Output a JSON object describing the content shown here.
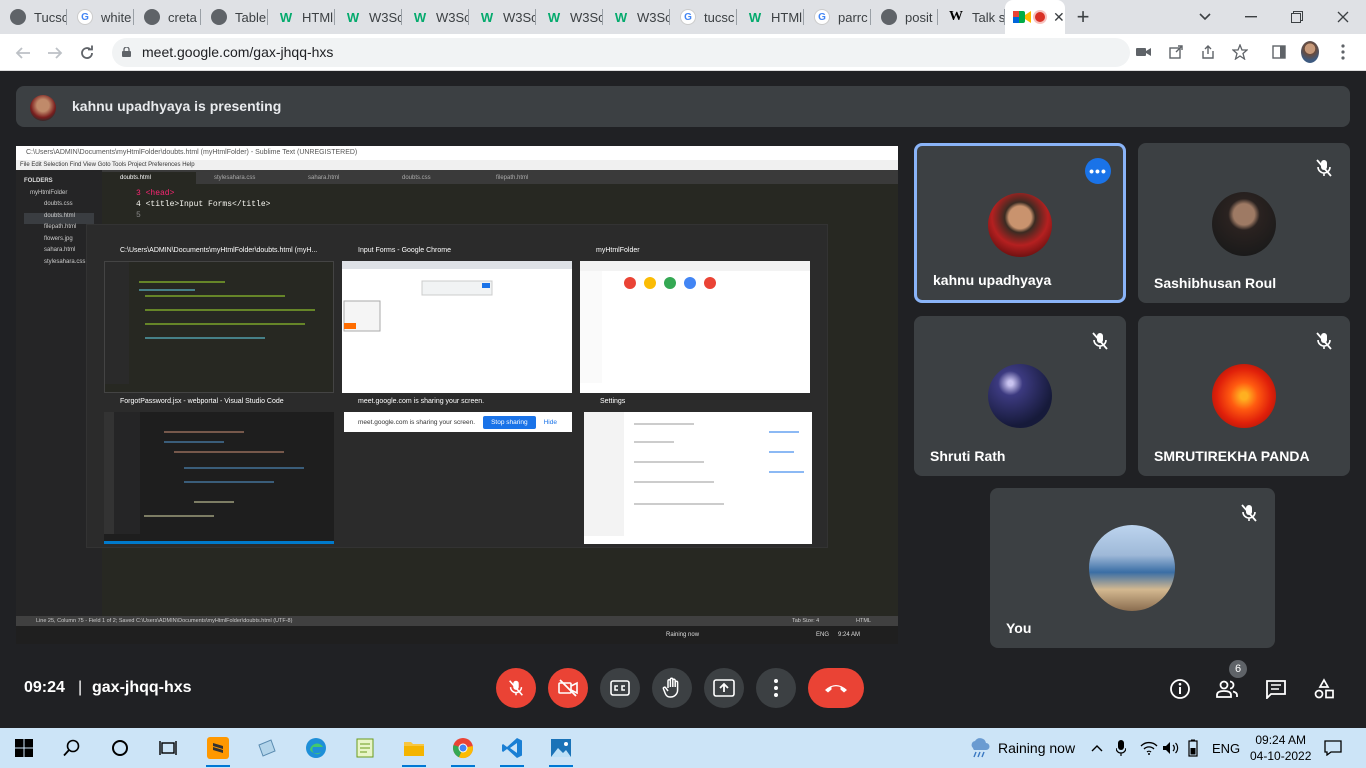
{
  "browser": {
    "tabs": [
      {
        "label": "Tucsc",
        "icon": "globe-icon"
      },
      {
        "label": "white",
        "icon": "google-icon"
      },
      {
        "label": "creta",
        "icon": "globe-icon"
      },
      {
        "label": "Table",
        "icon": "globe-icon"
      },
      {
        "label": "HTMl",
        "icon": "w3schools-icon"
      },
      {
        "label": "W3Sc",
        "icon": "w3schools-icon"
      },
      {
        "label": "W3Sc",
        "icon": "w3schools-icon"
      },
      {
        "label": "W3Sc",
        "icon": "w3schools-icon"
      },
      {
        "label": "W3Sc",
        "icon": "w3schools-icon"
      },
      {
        "label": "W3Sc",
        "icon": "w3schools-icon"
      },
      {
        "label": "tucsc",
        "icon": "google-icon"
      },
      {
        "label": "HTMl",
        "icon": "w3schools-icon"
      },
      {
        "label": "parrc",
        "icon": "google-icon"
      },
      {
        "label": "posit",
        "icon": "globe-icon"
      },
      {
        "label": "Talk s",
        "icon": "wikipedia-icon"
      }
    ],
    "url": "meet.google.com/gax-jhqq-hxs",
    "new_tab": "+"
  },
  "banner": {
    "presenter_text": "kahnu upadhyaya is presenting"
  },
  "shared_screen": {
    "title_bar": "C:\\Users\\ADMIN\\Documents\\myHtmlFolder\\doubts.html (myHtmlFolder) - Sublime Text (UNREGISTERED)",
    "menu": "File  Edit  Selection  Find  View  Goto  Tools  Project  Preferences  Help",
    "folders_label": "FOLDERS",
    "files": [
      "myHtmlFolder",
      "doubts.css",
      "doubts.html",
      "filepath.html",
      "flowers.jpg",
      "sahara.html",
      "stylesahara.css"
    ],
    "editor_tabs": [
      "doubts.html",
      "stylesahara.css",
      "sahara.html",
      "doubts.css",
      "filepath.html"
    ],
    "code_lines": [
      "3  <head>",
      "4      <title>Input Forms</title>",
      "5"
    ],
    "switcher_windows": [
      {
        "title": "C:\\Users\\ADMIN\\Documents\\myHtmlFolder\\doubts.html (myH..."
      },
      {
        "title": "Input Forms - Google Chrome"
      },
      {
        "title": "myHtmlFolder"
      },
      {
        "title": "ForgotPassword.jsx - webportal - Visual Studio Code"
      },
      {
        "title": "meet.google.com is sharing your screen."
      },
      {
        "title": "Settings"
      }
    ],
    "sharing_bar": {
      "text": "meet.google.com is sharing your screen.",
      "stop": "Stop sharing",
      "hide": "Hide"
    },
    "status_line": "Line 25, Column 75 - Field 1 of 2; Saved C:\\Users\\ADMIN\\Documents\\myHtmlFolder\\doubts.html (UTF-8)",
    "tab_size": "Tab Size: 4",
    "syntax": "HTML",
    "inner_taskbar_weather": "Raining now",
    "inner_taskbar_lang": "ENG",
    "inner_taskbar_time": "9:24 AM"
  },
  "participants": [
    {
      "name": "kahnu upadhyaya",
      "muted": false,
      "active": true
    },
    {
      "name": "Sashibhusan Roul",
      "muted": true
    },
    {
      "name": "Shruti Rath",
      "muted": true
    },
    {
      "name": "SMRUTIREKHA PANDA",
      "muted": true
    },
    {
      "name": "You",
      "muted": true
    }
  ],
  "meeting": {
    "time": "09:24",
    "separator": "|",
    "code": "gax-jhqq-hxs",
    "participant_count": "6"
  },
  "taskbar": {
    "weather": "Raining now",
    "language": "ENG",
    "time": "09:24 AM",
    "date": "04-10-2022"
  },
  "colors": {
    "meet_bg": "#202124",
    "tile_bg": "#3c4043",
    "end_call": "#ea4335",
    "active_border": "#8ab4f8",
    "taskbar": "#cce4f7"
  }
}
